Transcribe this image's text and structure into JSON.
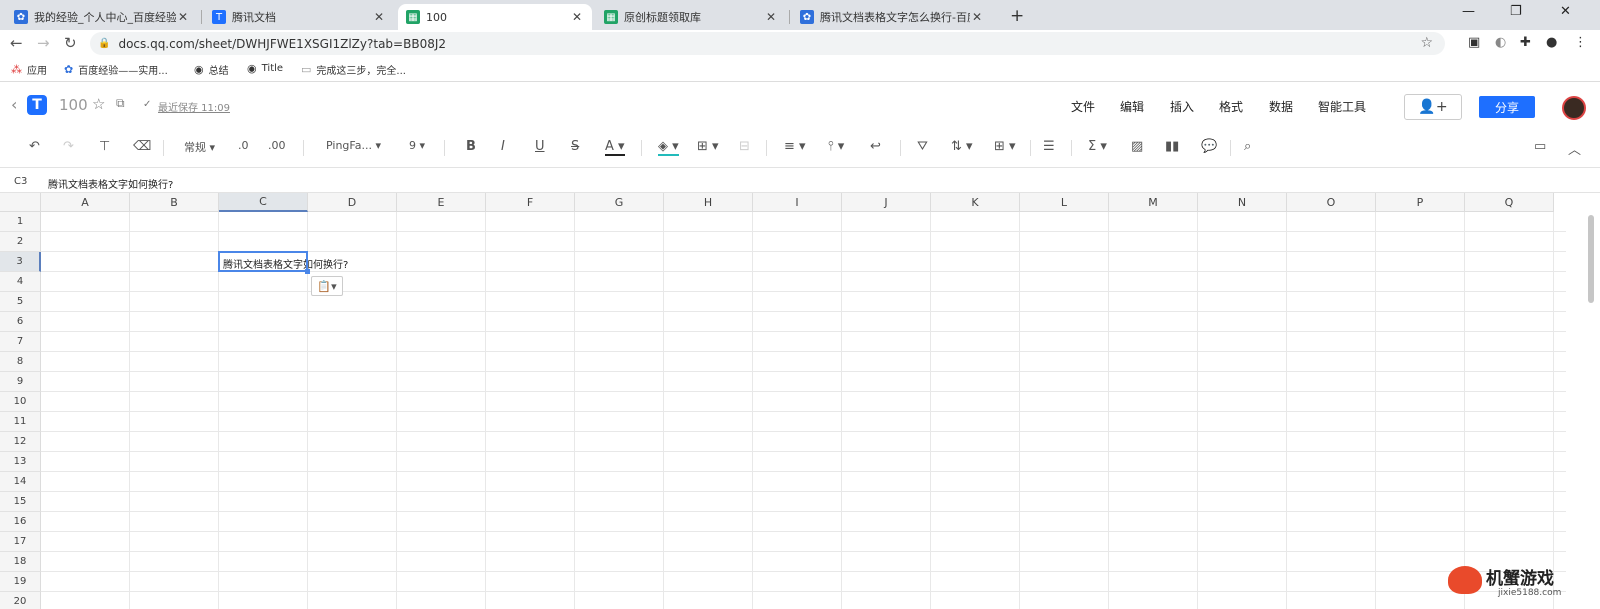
{
  "browser": {
    "tabs": [
      {
        "title": "我的经验_个人中心_百度经验",
        "icon": "baidu-paw-icon",
        "active": false
      },
      {
        "title": "腾讯文档",
        "icon": "tencent-docs-icon",
        "active": false
      },
      {
        "title": "100",
        "icon": "sheet-icon",
        "active": true
      },
      {
        "title": "原创标题领取库",
        "icon": "sheet-icon",
        "active": false
      },
      {
        "title": "腾讯文档表格文字怎么换行-百度",
        "icon": "baidu-paw-icon",
        "active": false
      }
    ],
    "close_glyph": "✕",
    "new_tab_glyph": "+",
    "url": "docs.qq.com/sheet/DWHJFWE1XSGI1ZlZy?tab=BB08J2",
    "bookmarks": [
      {
        "label": "应用",
        "icon": "apps-grid-icon"
      },
      {
        "label": "百度经验——实用...",
        "icon": "baidu-paw-icon"
      },
      {
        "label": "总结",
        "icon": "globe-icon"
      },
      {
        "label": "Title",
        "icon": "globe-icon"
      },
      {
        "label": "完成这三步，完全...",
        "icon": "page-icon"
      }
    ]
  },
  "doc": {
    "title": "100",
    "save_status": "最近保存 11:09",
    "menus": [
      "文件",
      "编辑",
      "插入",
      "格式",
      "数据",
      "智能工具"
    ],
    "share_label": "分享"
  },
  "toolbar": {
    "number_format": "常规",
    "decimal_decrease": ".0",
    "decimal_increase": ".00",
    "font_family": "PingFa...",
    "font_size": "9"
  },
  "formula_bar": {
    "cell_ref": "C3",
    "value": "腾讯文档表格文字如何换行?"
  },
  "sheet": {
    "columns": [
      "A",
      "B",
      "C",
      "D",
      "E",
      "F",
      "G",
      "H",
      "I",
      "J",
      "K",
      "L",
      "M",
      "N",
      "O",
      "P",
      "Q"
    ],
    "rows": [
      "1",
      "2",
      "3",
      "4",
      "5",
      "6",
      "7",
      "8",
      "9",
      "10",
      "11",
      "12",
      "13",
      "14",
      "15",
      "16",
      "17",
      "18",
      "19",
      "20"
    ],
    "selected_column": "C",
    "selected_row": "3",
    "cell_C3": "腾讯文档表格文字如何换行?"
  },
  "watermark": {
    "title": "机蟹游戏",
    "site": "jixie5188.com"
  },
  "colors": {
    "accent": "#1e6fff",
    "selection": "#4a86e8",
    "tab_strip": "#dee1e6"
  }
}
